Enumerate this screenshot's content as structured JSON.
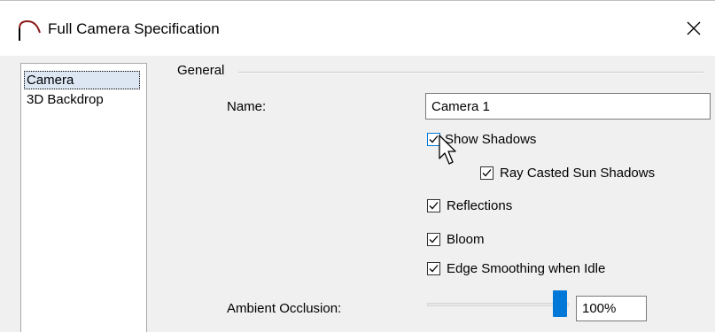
{
  "window": {
    "title": "Full Camera Specification",
    "icon": "camera-arc-icon",
    "close_icon": "close-icon"
  },
  "tree": {
    "items": [
      {
        "label": "Camera",
        "selected": true
      },
      {
        "label": "3D Backdrop",
        "selected": false
      }
    ]
  },
  "general": {
    "group_label": "General",
    "name_label": "Name:",
    "name_value": "Camera 1",
    "show_shadows": {
      "label": "Show Shadows",
      "checked": true
    },
    "ray_casted": {
      "label": "Ray Casted Sun Shadows",
      "checked": true
    },
    "reflections": {
      "label": "Reflections",
      "checked": true
    },
    "bloom": {
      "label": "Bloom",
      "checked": true
    },
    "edge_smoothing": {
      "label": "Edge Smoothing when Idle",
      "checked": true
    },
    "ambient_label": "Ambient Occlusion:",
    "ambient_value": "100%",
    "ambient_level": 1.0
  },
  "colors": {
    "accent": "#0078d7",
    "selection": "#dde7f4"
  }
}
